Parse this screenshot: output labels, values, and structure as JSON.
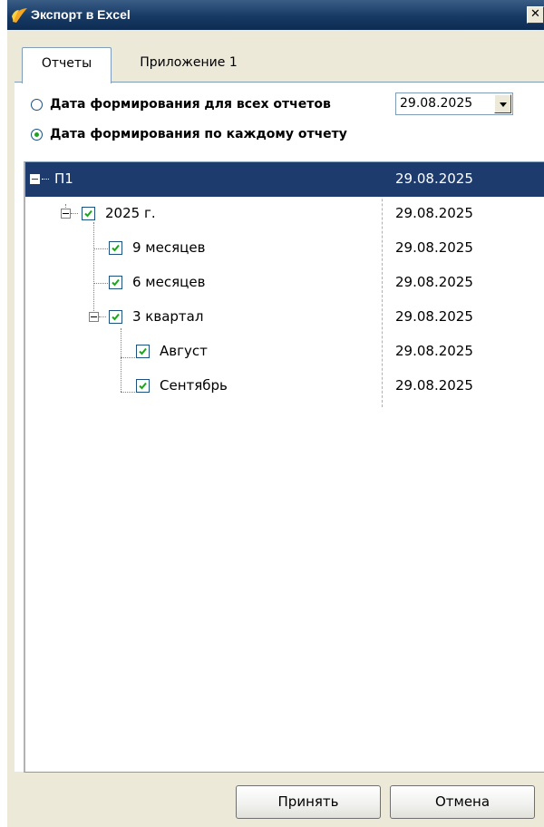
{
  "window": {
    "title": "Экспорт в Excel",
    "close_glyph": "✕"
  },
  "tabs": [
    {
      "label": "Отчеты",
      "active": true
    },
    {
      "label": "Приложение 1",
      "active": false
    }
  ],
  "date_options": {
    "all_reports_label": "Дата формирования для всех отчетов",
    "per_report_label": "Дата формирования по каждому отчету",
    "selected": "per_report",
    "common_date": "29.08.2025"
  },
  "tree": {
    "nodes": [
      {
        "label": "П1",
        "date": "29.08.2025",
        "level": 0,
        "checked": null,
        "expandable": true,
        "selected": true
      },
      {
        "label": "2025 г.",
        "date": "29.08.2025",
        "level": 1,
        "checked": true,
        "expandable": true,
        "selected": false
      },
      {
        "label": "9 месяцев",
        "date": "29.08.2025",
        "level": 2,
        "checked": true,
        "expandable": false,
        "selected": false
      },
      {
        "label": "6 месяцев",
        "date": "29.08.2025",
        "level": 2,
        "checked": true,
        "expandable": false,
        "selected": false
      },
      {
        "label": "3 квартал",
        "date": "29.08.2025",
        "level": 2,
        "checked": true,
        "expandable": true,
        "selected": false
      },
      {
        "label": "Август",
        "date": "29.08.2025",
        "level": 3,
        "checked": true,
        "expandable": false,
        "selected": false
      },
      {
        "label": "Сентябрь",
        "date": "29.08.2025",
        "level": 3,
        "checked": true,
        "expandable": false,
        "selected": false
      }
    ]
  },
  "buttons": {
    "accept_label": "Принять",
    "cancel_label": "Отмена"
  },
  "colors": {
    "title_bar": "#163a64",
    "selection": "#1d3b6c",
    "check": "#21a121",
    "face": "#ece9d8"
  }
}
